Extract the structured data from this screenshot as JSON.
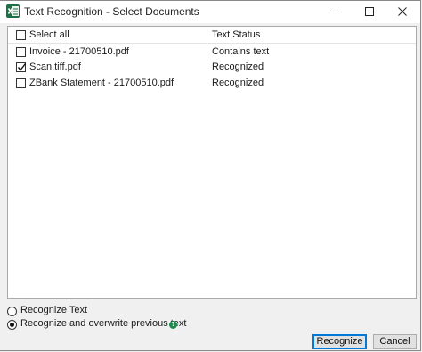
{
  "window": {
    "title": "Text Recognition - Select Documents",
    "icon": "excel-app-icon",
    "controls": [
      "minimize-icon",
      "maximize-icon",
      "close-icon"
    ]
  },
  "list": {
    "select_all_label": "Select all",
    "select_all_checked": false,
    "status_header": "Text Status",
    "rows": [
      {
        "name": "Invoice - 21700510.pdf",
        "status": "Contains text",
        "checked": false
      },
      {
        "name": "Scan.tiff.pdf",
        "status": "Recognized",
        "checked": true
      },
      {
        "name": "ZBank Statement - 21700510.pdf",
        "status": "Recognized",
        "checked": false
      }
    ]
  },
  "options": {
    "recognize_text_label": "Recognize Text",
    "recognize_overwrite_label": "Recognize and overwrite previous text",
    "selected": "recognize_overwrite",
    "help_icon_glyph": "?"
  },
  "buttons": {
    "recognize_label": "Recognize",
    "cancel_label": "Cancel"
  },
  "colors": {
    "accent": "#0078d7",
    "excel_green": "#1d7044",
    "help_green": "#1f8a4c"
  }
}
